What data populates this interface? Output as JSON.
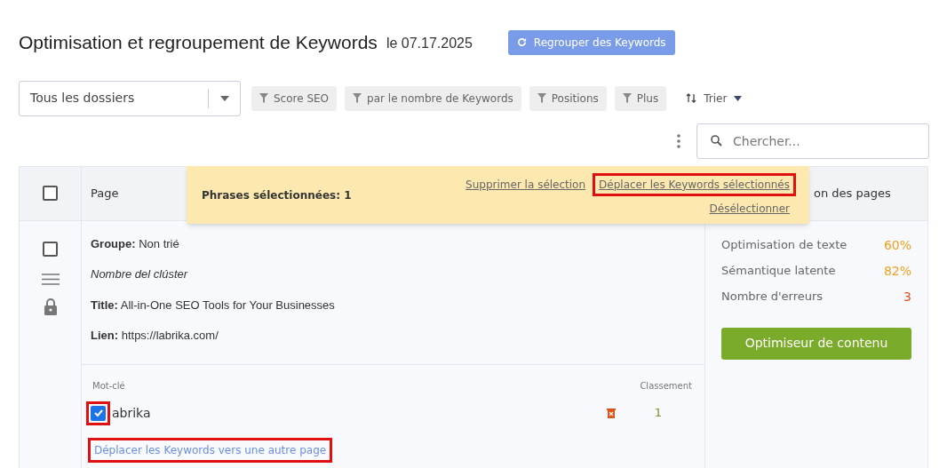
{
  "header": {
    "title": "Optimisation et regroupement de Keywords",
    "date": "le 07.17.2025",
    "regroup_button": "Regrouper des Keywords"
  },
  "filters": {
    "folder_select": "Tous les dossiers",
    "chips": [
      "Score SEO",
      "par le nombre de Keywords",
      "Positions",
      "Plus"
    ],
    "sort": "Trier"
  },
  "search": {
    "placeholder": "Chercher..."
  },
  "table": {
    "select_all": {
      "checked": false
    },
    "columns": [
      "Page",
      "on des pages"
    ]
  },
  "selection_bar": {
    "label": "Phrases sélectionnées: 1",
    "actions": [
      {
        "text": "Supprimer la sélection",
        "highlighted": false
      },
      {
        "text": "Déplacer les Keywords sélectionnés",
        "highlighted": true
      },
      {
        "text": "Désélectionner",
        "highlighted": false
      }
    ]
  },
  "row": {
    "checked": false,
    "details": [
      {
        "label": "Groupe:",
        "value": "Non trié"
      },
      {
        "value": "Nombre del clúster"
      },
      {
        "label": "Title:",
        "value": "All-in-One SEO Tools for Your Businesses"
      },
      {
        "label": "Lien:",
        "value": "https://labrika.com/"
      }
    ],
    "keywords_header": {
      "keyword": "Mot-clé",
      "rank": "Classement"
    },
    "keywords": [
      {
        "text": "abrika",
        "checked": true,
        "highlighted": true,
        "rank": "1"
      }
    ],
    "move_link": {
      "text": "Déplacer les Keywords vers une autre page",
      "highlighted": true
    },
    "metrics": [
      {
        "label": "Optimisation de texte",
        "value": "60%",
        "color": "#f0a020"
      },
      {
        "label": "Sémantique latente",
        "value": "82%",
        "color": "#f0a020"
      },
      {
        "label": "Nombre d'erreurs",
        "value": "3",
        "color": "#e0501a"
      }
    ],
    "optimizer_button": "Optimiseur de contenu"
  }
}
